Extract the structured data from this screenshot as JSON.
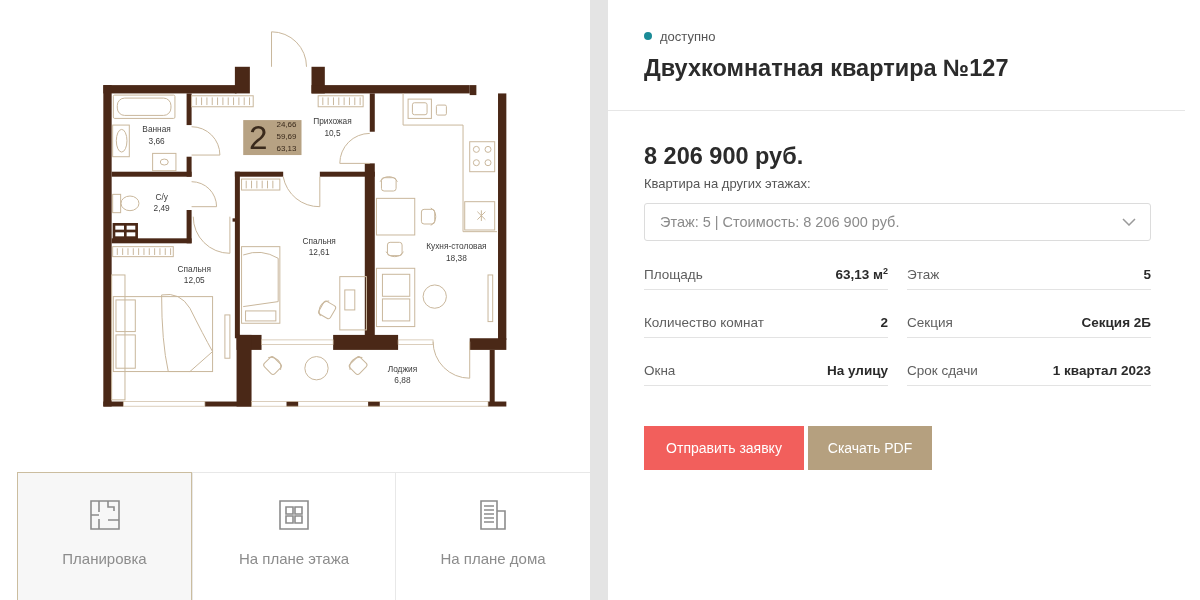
{
  "plan": {
    "badge": {
      "rooms": "2",
      "areas": [
        "24,66",
        "59,69",
        "63,13"
      ]
    },
    "rooms": [
      {
        "name": "Ванная",
        "area": "3,66"
      },
      {
        "name": "Прихожая",
        "area": "10,5"
      },
      {
        "name": "С/у",
        "area": "2,49"
      },
      {
        "name": "Спальня",
        "area": "12,61"
      },
      {
        "name": "Спальня",
        "area": "12,05"
      },
      {
        "name": "Кухня-столовая",
        "area": "18,38"
      },
      {
        "name": "Лоджия",
        "area": "6,88"
      }
    ]
  },
  "tabs": [
    {
      "label": "Планировка",
      "selected": true,
      "kind": "plan"
    },
    {
      "label": "На плане этажа",
      "selected": false,
      "kind": "floor"
    },
    {
      "label": "На плане дома",
      "selected": false,
      "kind": "building"
    }
  ],
  "status": {
    "label": "доступно"
  },
  "title": "Двухкомнатная квартира №127",
  "price": "8 206 900 руб.",
  "other_floors": {
    "label": "Квартира на других этажах:",
    "value": "Этаж: 5 | Стоимость: 8 206 900 руб."
  },
  "specs": [
    {
      "label": "Площадь",
      "value": "63,13 м$^{2}$"
    },
    {
      "label": "Этаж",
      "value": "5"
    },
    {
      "label": "Количество комнат",
      "value": "2"
    },
    {
      "label": "Секция",
      "value": "Секция 2Б"
    },
    {
      "label": "Окна",
      "value": "На улицу"
    },
    {
      "label": "Срок сдачи",
      "value": "1 квартал 2023"
    }
  ],
  "buttons": [
    {
      "label": "Отправить заявку",
      "kind": "primary"
    },
    {
      "label": "Скачать PDF",
      "kind": "secondary"
    }
  ]
}
